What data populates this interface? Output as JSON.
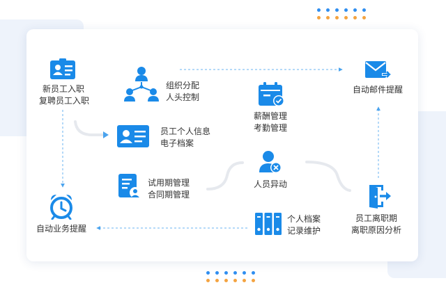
{
  "colors": {
    "accent": "#1a8ae8",
    "connector_dash": "#6ab3f0",
    "connector_gray": "#e6e9ee",
    "dot_blue": "#2f8ef0",
    "dot_orange": "#f4a340"
  },
  "nodes": {
    "onboarding": {
      "icon": "id-card-icon",
      "lines": [
        "新员工入职",
        "复聘员工入职"
      ]
    },
    "org": {
      "icon": "org-chart-icon",
      "lines": [
        "组织分配",
        "人头控制"
      ]
    },
    "payroll": {
      "icon": "calendar-check-icon",
      "lines": [
        "薪酬管理",
        "考勤管理"
      ]
    },
    "email": {
      "icon": "mail-send-icon",
      "lines": [
        "自动邮件提醒"
      ]
    },
    "profile": {
      "icon": "profile-card-icon",
      "lines": [
        "员工个人信息",
        "电子档案"
      ]
    },
    "probation": {
      "icon": "contract-doc-icon",
      "lines": [
        "试用期管理",
        "合同期管理"
      ]
    },
    "change": {
      "icon": "user-remove-icon",
      "lines": [
        "人员异动"
      ]
    },
    "alarm": {
      "icon": "alarm-clock-icon",
      "lines": [
        "自动业务提醒"
      ]
    },
    "archive": {
      "icon": "archive-binders-icon",
      "lines": [
        "个人档案",
        "记录维护"
      ]
    },
    "exit": {
      "icon": "exit-door-icon",
      "lines": [
        "员工离职期",
        "离职原因分析"
      ]
    }
  }
}
